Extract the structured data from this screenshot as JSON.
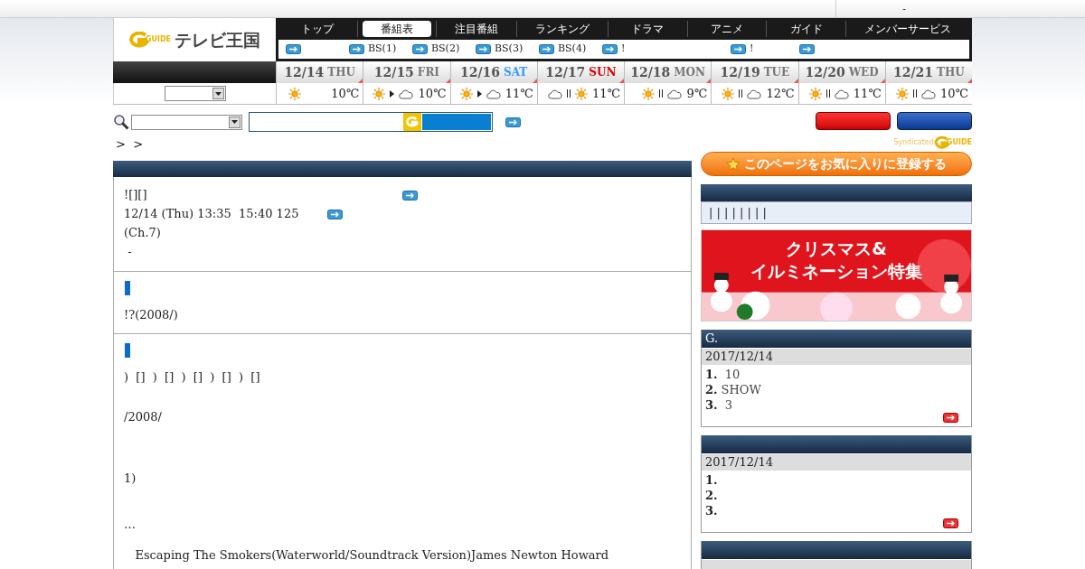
{
  "top_bar": {
    "box_text": "-"
  },
  "logo": {
    "mark": "GUIDE",
    "name": "テレビ王国"
  },
  "nav": {
    "tabs": [
      {
        "label": "トップ",
        "selected": false
      },
      {
        "label": "番組表",
        "selected": true
      },
      {
        "label": "注目番組",
        "selected": false
      },
      {
        "label": "ランキング",
        "selected": false
      },
      {
        "label": "ドラマ",
        "selected": false
      },
      {
        "label": "アニメ",
        "selected": false
      },
      {
        "label": "ガイド",
        "selected": false
      },
      {
        "label": "メンバーサービス",
        "selected": false
      }
    ],
    "sub_links": [
      {
        "kind": "icon_only"
      },
      {
        "kind": "labeled",
        "label": "BS(1)"
      },
      {
        "kind": "labeled",
        "label": "BS(2)"
      },
      {
        "kind": "labeled",
        "label": "BS(3)"
      },
      {
        "kind": "labeled",
        "label": "BS(4)"
      },
      {
        "kind": "labeled",
        "label": "!"
      },
      {
        "kind": "labeled",
        "label": "!"
      },
      {
        "kind": "icon_only"
      }
    ]
  },
  "days": [
    {
      "date": "12/14",
      "weekday": "THU",
      "color": "#777777",
      "weather": [
        {
          "kind": "sun"
        }
      ],
      "temp": "10℃"
    },
    {
      "date": "12/15",
      "weekday": "FRI",
      "color": "#777777",
      "weather": [
        {
          "kind": "sun"
        },
        {
          "kind": "then"
        },
        {
          "kind": "cloud"
        }
      ],
      "temp": "10℃"
    },
    {
      "date": "12/16",
      "weekday": "SAT",
      "color": "#3399ff",
      "weather": [
        {
          "kind": "sun"
        },
        {
          "kind": "then"
        },
        {
          "kind": "cloud"
        }
      ],
      "temp": "11℃"
    },
    {
      "date": "12/17",
      "weekday": "SUN",
      "color": "#dd0000",
      "weather": [
        {
          "kind": "cloud"
        },
        {
          "kind": "sometimes"
        },
        {
          "kind": "sun"
        }
      ],
      "temp": "11℃"
    },
    {
      "date": "12/18",
      "weekday": "MON",
      "color": "#777777",
      "weather": [
        {
          "kind": "sun"
        },
        {
          "kind": "sometimes"
        },
        {
          "kind": "cloud"
        }
      ],
      "temp": "9℃"
    },
    {
      "date": "12/19",
      "weekday": "TUE",
      "color": "#777777",
      "weather": [
        {
          "kind": "sun"
        },
        {
          "kind": "sometimes"
        },
        {
          "kind": "cloud"
        }
      ],
      "temp": "12℃"
    },
    {
      "date": "12/20",
      "weekday": "WED",
      "color": "#777777",
      "weather": [
        {
          "kind": "sun"
        },
        {
          "kind": "sometimes"
        },
        {
          "kind": "cloud"
        }
      ],
      "temp": "11℃"
    },
    {
      "date": "12/21",
      "weekday": "THU",
      "color": "#777777",
      "weather": [
        {
          "kind": "sun"
        },
        {
          "kind": "sometimes"
        },
        {
          "kind": "cloud"
        }
      ],
      "temp": "10℃"
    }
  ],
  "search": {
    "breadcrumb": ">  >"
  },
  "syndicated": {
    "text": "Syndicated",
    "mark": "GUIDE"
  },
  "program": {
    "sections": [
      {
        "kind": "info",
        "lines": [
          {
            "text": "![][]",
            "link": true
          },
          {
            "text": "12/14 (Thu) 13:35  15:40 125",
            "link": true
          },
          {
            "text": "(Ch.7)"
          },
          {
            "text": " -"
          }
        ]
      },
      {
        "kind": "marked",
        "lines": [
          {
            "text": "!?(2008/)"
          }
        ]
      },
      {
        "kind": "marked",
        "lines": [
          {
            "text": ")  []  )  []  )  []  )  []  )  []"
          },
          {
            "text": "/2008/"
          },
          {
            "text": "1)"
          },
          {
            "text": "…"
          },
          {
            "text": "   Escaping The Smokers(Waterworld/Soundtrack Version)James Newton Howard"
          }
        ]
      }
    ]
  },
  "favorite": {
    "label": "このページをお気に入りに登録する"
  },
  "genre_bar": {
    "text": "| | | | | | | |"
  },
  "banner": {
    "title": "クリスマス&",
    "subtitle": "イルミネーション特集"
  },
  "rankings": [
    {
      "kind": "full",
      "title": "G.",
      "date": "2017/12/14",
      "items": [
        {
          "rank": "1.",
          "label": " 10"
        },
        {
          "rank": "2.",
          "label": "SHOW"
        },
        {
          "rank": "3.",
          "label": " 3"
        }
      ]
    },
    {
      "kind": "full",
      "date": "2017/12/14",
      "items": [
        {
          "rank": "1."
        },
        {
          "rank": "2."
        },
        {
          "rank": "3."
        }
      ]
    },
    {
      "kind": "cut"
    }
  ]
}
